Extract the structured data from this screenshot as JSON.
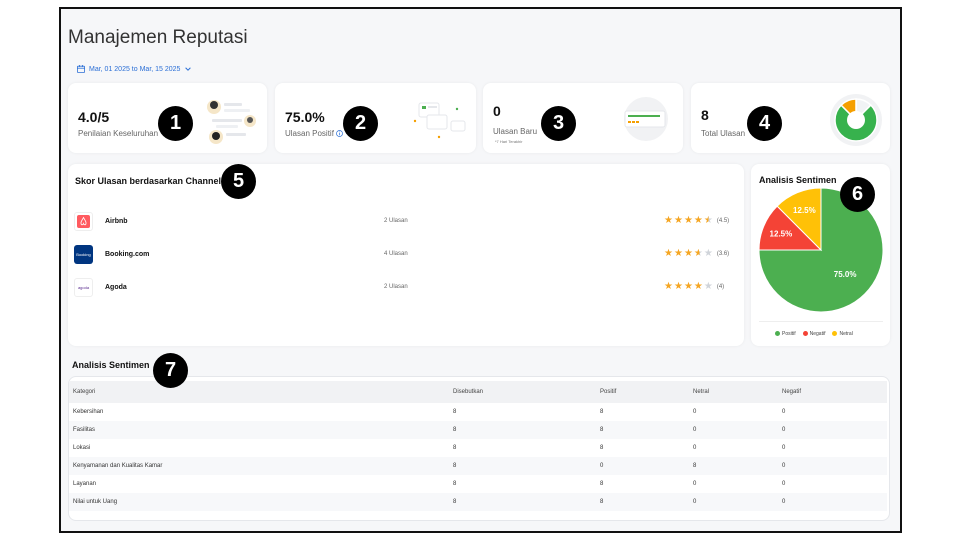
{
  "page": {
    "title": "Manajemen Reputasi"
  },
  "date_filter": {
    "label": "Mar, 01 2025 to Mar, 15 2025"
  },
  "kpis": [
    {
      "value": "4.0/5",
      "label": "Penilaian Keseluruhan",
      "sub": ""
    },
    {
      "value": "75.0%",
      "label": "Ulasan Positif",
      "sub": ""
    },
    {
      "value": "0",
      "label": "Ulasan Baru",
      "sub": "*7 Hari Terakhir"
    },
    {
      "value": "8",
      "label": "Total Ulasan",
      "sub": ""
    }
  ],
  "badges": [
    "1",
    "2",
    "3",
    "4",
    "5",
    "6",
    "7"
  ],
  "channels": {
    "title": "Skor Ulasan berdasarkan Channel",
    "items": [
      {
        "name": "Airbnb",
        "count": "2 Ulasan",
        "rating": 4.5,
        "score": "(4.5)",
        "logo_text": ""
      },
      {
        "name": "Booking.com",
        "count": "4 Ulasan",
        "rating": 3.6,
        "score": "(3.6)",
        "logo_text": "Booking"
      },
      {
        "name": "Agoda",
        "count": "2 Ulasan",
        "rating": 4,
        "score": "(4)",
        "logo_text": "agoda"
      }
    ]
  },
  "sentiment_chart": {
    "title": "Analisis Sentimen",
    "legend": [
      "Positif",
      "Negatif",
      "Netral"
    ],
    "colors": {
      "positive": "#4caf50",
      "negative": "#f44336",
      "neutral": "#ffc107"
    }
  },
  "chart_data": {
    "type": "pie",
    "title": "Analisis Sentimen",
    "slices": [
      {
        "name": "Positif",
        "value": 75.0,
        "label": "75.0%"
      },
      {
        "name": "Negatif",
        "value": 12.5,
        "label": "12.5%"
      },
      {
        "name": "Netral",
        "value": 12.5,
        "label": "12.5%"
      }
    ],
    "legend_placement": "bottom"
  },
  "total_reviews_donut": {
    "positive": 75.0,
    "neutral": 12.5,
    "rest": 12.5
  },
  "sentiment_table": {
    "title": "Analisis Sentimen",
    "headers": [
      "Kategori",
      "Disebutkan",
      "Positif",
      "Netral",
      "Negatif"
    ],
    "rows": [
      [
        "Kebersihan",
        "8",
        "8",
        "0",
        "0"
      ],
      [
        "Fasilitas",
        "8",
        "8",
        "0",
        "0"
      ],
      [
        "Lokasi",
        "8",
        "8",
        "0",
        "0"
      ],
      [
        "Kenyamanan dan Kualitas Kamar",
        "8",
        "0",
        "8",
        "0"
      ],
      [
        "Layanan",
        "8",
        "8",
        "0",
        "0"
      ],
      [
        "Nilai untuk Uang",
        "8",
        "8",
        "0",
        "0"
      ]
    ]
  }
}
